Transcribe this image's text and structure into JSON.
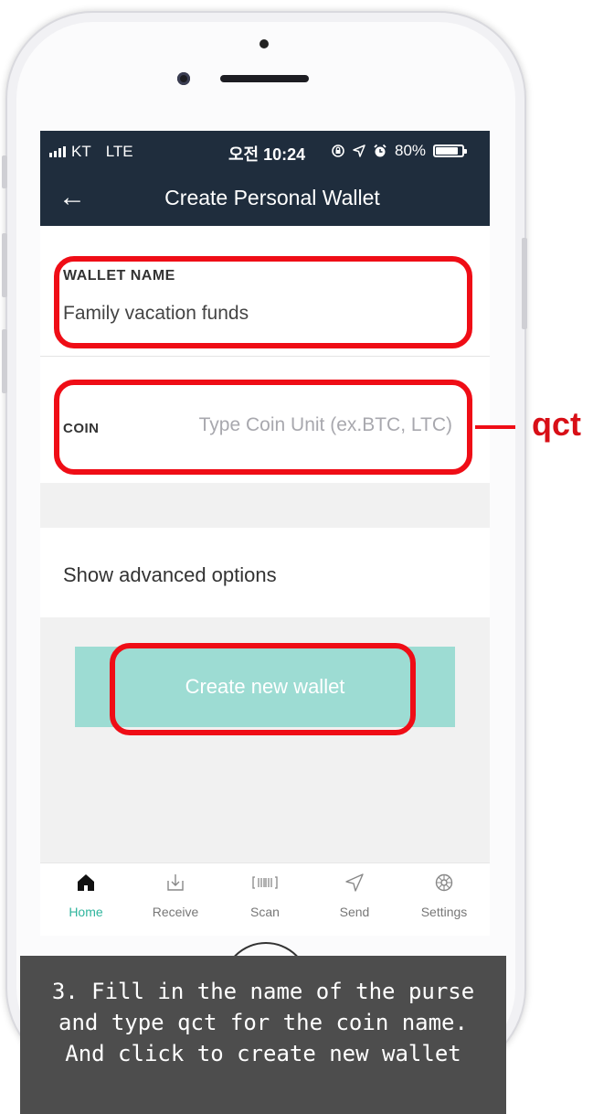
{
  "status_bar": {
    "carrier": "KT",
    "network": "LTE",
    "time": "오전 10:24",
    "battery": "80%",
    "battery_level": 0.8
  },
  "header": {
    "title": "Create Personal Wallet"
  },
  "form": {
    "wallet_name_label": "WALLET NAME",
    "wallet_name_value": "Family vacation funds",
    "coin_label": "COIN",
    "coin_placeholder": "Type Coin Unit (ex.BTC, LTC)"
  },
  "advanced": {
    "label": "Show advanced options"
  },
  "create_button": {
    "label": "Create new wallet"
  },
  "tabs": [
    {
      "label": "Home",
      "icon": "home-icon",
      "active": true
    },
    {
      "label": "Receive",
      "icon": "receive-icon",
      "active": false
    },
    {
      "label": "Scan",
      "icon": "barcode-scan-icon",
      "active": false
    },
    {
      "label": "Send",
      "icon": "send-icon",
      "active": false
    },
    {
      "label": "Settings",
      "icon": "gear-icon",
      "active": false
    }
  ],
  "annotations": {
    "coin_callout": "qct",
    "caption_lines": [
      "3. Fill in the name of the purse",
      "and type qct for the coin name.",
      "And click to create new wallet"
    ]
  },
  "colors": {
    "header_bg": "#1f2d3d",
    "button_bg": "#9ddcd3",
    "active_tab": "#2fb59d",
    "highlight": "#ef0d16"
  }
}
